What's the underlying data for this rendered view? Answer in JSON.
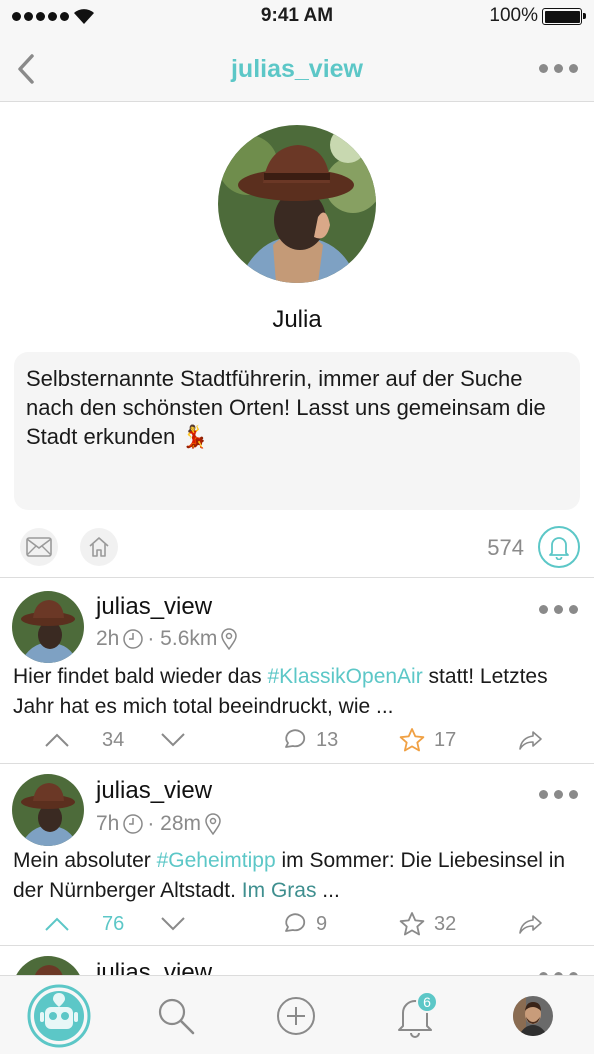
{
  "status": {
    "time": "9:41 AM",
    "battery": "100%"
  },
  "nav": {
    "title": "julias_view"
  },
  "profile": {
    "name": "Julia",
    "bio": "Selbsternannte Stadtführerin, immer auf der Suche nach den schönsten Orten! Lasst uns gemeinsam die Stadt erkunden 💃",
    "followers": "574"
  },
  "posts": [
    {
      "user": "julias_view",
      "time": "2h",
      "distance": "· 5.6km",
      "text_before": "Hier findet bald wieder das ",
      "hashtag": "#KlassikOpenAir",
      "text_after": " statt! Letztes Jahr hat es mich total beeindruckt, wie ...",
      "votes": "34",
      "comments": "13",
      "stars": "17"
    },
    {
      "user": "julias_view",
      "time": "7h",
      "distance": "· 28m",
      "text_before": "Mein absoluter ",
      "hashtag": "#Geheimtipp",
      "text_after": " im Sommer: Die Liebesinsel in der Nürnberger Altstadt. ",
      "text_link": "Im Gras",
      "text_end": " ...",
      "votes": "76",
      "comments": "9",
      "stars": "32"
    },
    {
      "user": "julias_view"
    }
  ],
  "tabbar": {
    "notification_count": "6"
  },
  "colors": {
    "accent": "#5cc7c7",
    "star": "#f0a043",
    "muted": "#8a8a8a"
  }
}
